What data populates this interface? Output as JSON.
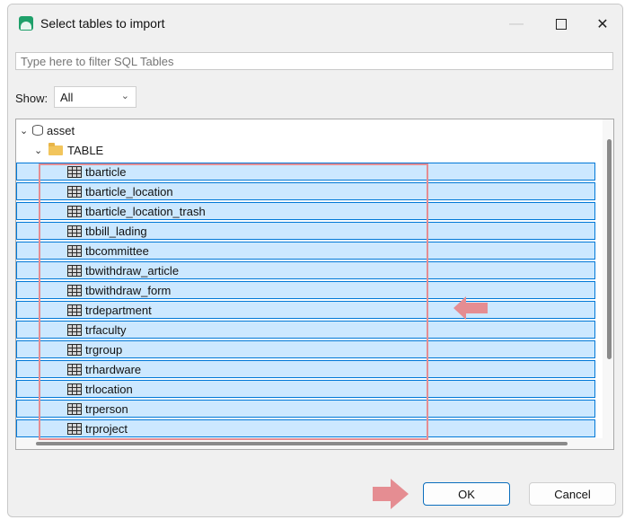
{
  "window": {
    "title": "Select tables to import"
  },
  "filter": {
    "placeholder": "Type here to filter SQL Tables"
  },
  "show": {
    "label": "Show:",
    "selected": "All"
  },
  "tree": {
    "database": "asset",
    "folder": "TABLE",
    "tables": [
      "tbarticle",
      "tbarticle_location",
      "tbarticle_location_trash",
      "tbbill_lading",
      "tbcommittee",
      "tbwithdraw_article",
      "tbwithdraw_form",
      "trdepartment",
      "trfaculty",
      "trgroup",
      "trhardware",
      "trlocation",
      "trperson",
      "trproject"
    ]
  },
  "buttons": {
    "ok": "OK",
    "cancel": "Cancel"
  },
  "colors": {
    "selection_bg": "#cce8ff",
    "selection_border": "#0078d7",
    "annotation": "#e58d92"
  },
  "icons": {
    "app": "app-logo-icon",
    "database": "database-icon",
    "folder": "folder-icon",
    "table": "table-icon"
  }
}
